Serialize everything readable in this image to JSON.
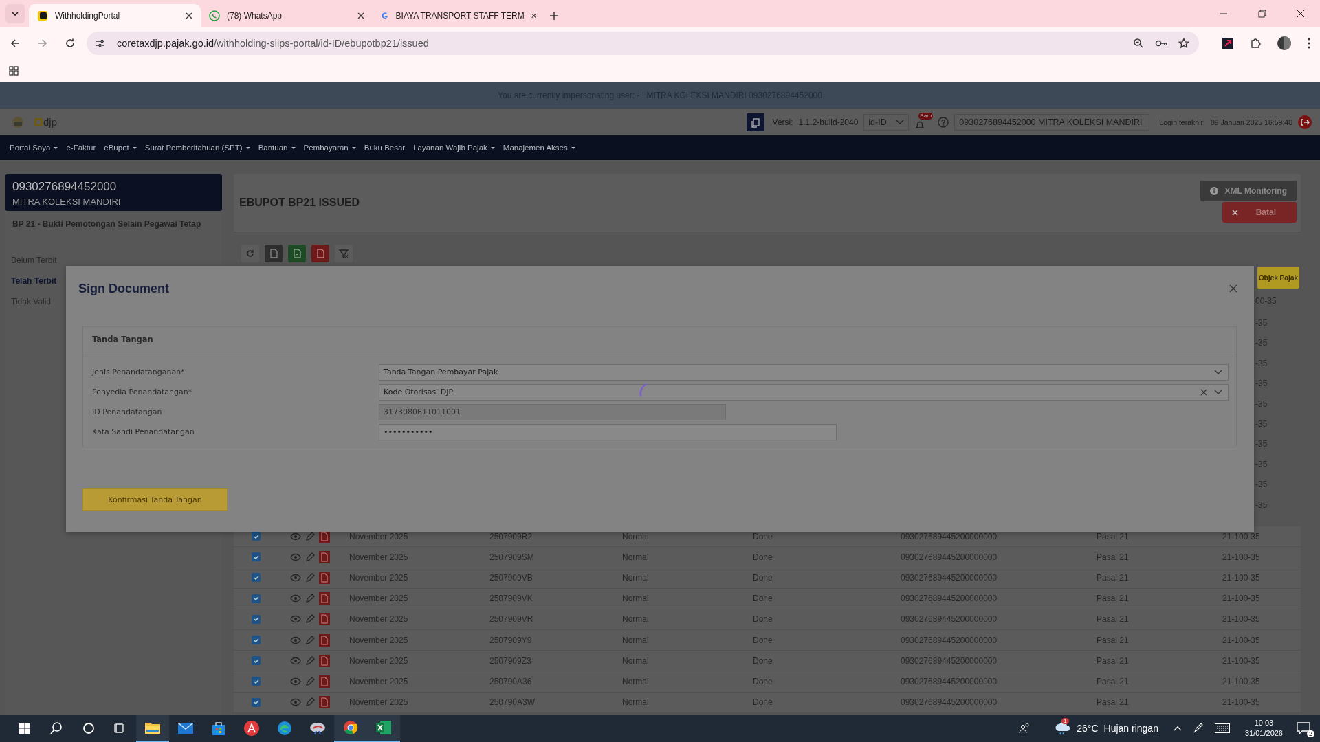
{
  "browser": {
    "tabs": [
      {
        "title": "WithholdingPortal",
        "kind": "portal",
        "selected": true
      },
      {
        "title": "(78) WhatsApp",
        "kind": "whatsapp",
        "selected": false
      },
      {
        "title": "BIAYA TRANSPORT STAFF TERM",
        "kind": "google",
        "selected": false
      }
    ],
    "url_host": "coretaxdjp.pajak.go.id",
    "url_path": "/withholding-slips-portal/id-ID/ebupotbp21/issued"
  },
  "impersonation_banner": "You are currently impersonating user: - ! MITRA KOLEKSI MANDIRI 0930276894452000",
  "header": {
    "brand": "djp",
    "version_label": "Versi:",
    "version": "1.1.2-build-2040",
    "language": "id-ID",
    "notification_badge": "Baru",
    "account": "0930276894452000 MITRA KOLEKSI MANDIRI",
    "login_label": "Login terakhir:",
    "login_time": "09 Januari 2025 16:59:40"
  },
  "nav": [
    {
      "label": "Portal Saya",
      "dropdown": true
    },
    {
      "label": "e-Faktur",
      "dropdown": false
    },
    {
      "label": "eBupot",
      "dropdown": true
    },
    {
      "label": "Surat Pemberitahuan (SPT)",
      "dropdown": true
    },
    {
      "label": "Bantuan",
      "dropdown": true
    },
    {
      "label": "Pembayaran",
      "dropdown": true
    },
    {
      "label": "Buku Besar",
      "dropdown": false
    },
    {
      "label": "Layanan Wajib Pajak",
      "dropdown": true
    },
    {
      "label": "Manajemen Akses",
      "dropdown": true
    }
  ],
  "sidebar": {
    "npwp": "0930276894452000",
    "name": "MITRA KOLEKSI MANDIRI",
    "section": "BP 21 - Bukti Pemotongan Selain Pegawai Tetap",
    "items": [
      {
        "label": "Belum Terbit",
        "selected": false
      },
      {
        "label": "Telah Terbit",
        "selected": true
      },
      {
        "label": "Tidak Valid",
        "selected": false
      }
    ]
  },
  "main": {
    "title": "EBUPOT BP21 ISSUED",
    "buttons": [
      {
        "label": "XML Monitoring",
        "kind": "info"
      },
      {
        "label": "Batal",
        "kind": "danger"
      }
    ],
    "toolbar": [
      {
        "kind": "refresh"
      },
      {
        "kind": "file"
      },
      {
        "kind": "excel"
      },
      {
        "kind": "pdf"
      },
      {
        "kind": "filter-clear"
      }
    ]
  },
  "table": {
    "header_partial": "Objek Pajak",
    "filter_partial": "00-35",
    "cells_partial": [
      "-35",
      "-35",
      "-35",
      "-35",
      "-35",
      "-35",
      "-35",
      "-35",
      "-35",
      "-35"
    ],
    "rows": [
      {
        "checked": true,
        "period": "November 2025",
        "number": "2507909R2",
        "type": "Normal",
        "status": "Done",
        "id": "093027689445200000000",
        "pasal": "Pasal 21",
        "code": "21-100-35"
      },
      {
        "checked": true,
        "period": "November 2025",
        "number": "2507909SM",
        "type": "Normal",
        "status": "Done",
        "id": "093027689445200000000",
        "pasal": "Pasal 21",
        "code": "21-100-35"
      },
      {
        "checked": true,
        "period": "November 2025",
        "number": "2507909VB",
        "type": "Normal",
        "status": "Done",
        "id": "093027689445200000000",
        "pasal": "Pasal 21",
        "code": "21-100-35"
      },
      {
        "checked": true,
        "period": "November 2025",
        "number": "2507909VK",
        "type": "Normal",
        "status": "Done",
        "id": "093027689445200000000",
        "pasal": "Pasal 21",
        "code": "21-100-35"
      },
      {
        "checked": true,
        "period": "November 2025",
        "number": "2507909VR",
        "type": "Normal",
        "status": "Done",
        "id": "093027689445200000000",
        "pasal": "Pasal 21",
        "code": "21-100-35"
      },
      {
        "checked": true,
        "period": "November 2025",
        "number": "2507909Y9",
        "type": "Normal",
        "status": "Done",
        "id": "093027689445200000000",
        "pasal": "Pasal 21",
        "code": "21-100-35"
      },
      {
        "checked": true,
        "period": "November 2025",
        "number": "2507909Z3",
        "type": "Normal",
        "status": "Done",
        "id": "093027689445200000000",
        "pasal": "Pasal 21",
        "code": "21-100-35"
      },
      {
        "checked": true,
        "period": "November 2025",
        "number": "250790A36",
        "type": "Normal",
        "status": "Done",
        "id": "093027689445200000000",
        "pasal": "Pasal 21",
        "code": "21-100-35"
      },
      {
        "checked": true,
        "period": "November 2025",
        "number": "250790A3W",
        "type": "Normal",
        "status": "Done",
        "id": "093027689445200000000",
        "pasal": "Pasal 21",
        "code": "21-100-35"
      }
    ]
  },
  "modal": {
    "title": "Sign Document",
    "section": "Tanda Tangan",
    "fields": [
      {
        "label": "Jenis Penandatanganan*",
        "value": "Tanda Tangan Pembayar Pajak",
        "kind": "select",
        "clearable": false
      },
      {
        "label": "Penyedia Penandatangan*",
        "value": "Kode Otorisasi DJP",
        "kind": "select",
        "clearable": true
      },
      {
        "label": "ID Penandatangan",
        "value": "3173080611011001",
        "kind": "text",
        "disabled": true
      },
      {
        "label": "Kata Sandi Penandatangan",
        "value": "•••••••••••",
        "kind": "password",
        "disabled": false
      }
    ],
    "confirm_button": "Konfirmasi Tanda Tangan",
    "loading": true
  },
  "taskbar": {
    "apps": [
      {
        "kind": "explorer",
        "running": true
      },
      {
        "kind": "mail",
        "running": false
      },
      {
        "kind": "store",
        "running": false
      },
      {
        "kind": "acrobat",
        "running": false
      },
      {
        "kind": "edge",
        "running": false
      },
      {
        "kind": "app",
        "running": false
      },
      {
        "kind": "chrome",
        "running": true
      },
      {
        "kind": "excel",
        "running": true
      }
    ],
    "weather_badge": "1",
    "temperature": "26°C",
    "weather": "Hujan ringan",
    "time": "10:03",
    "date": "31/01/2026",
    "notifications": "2"
  }
}
